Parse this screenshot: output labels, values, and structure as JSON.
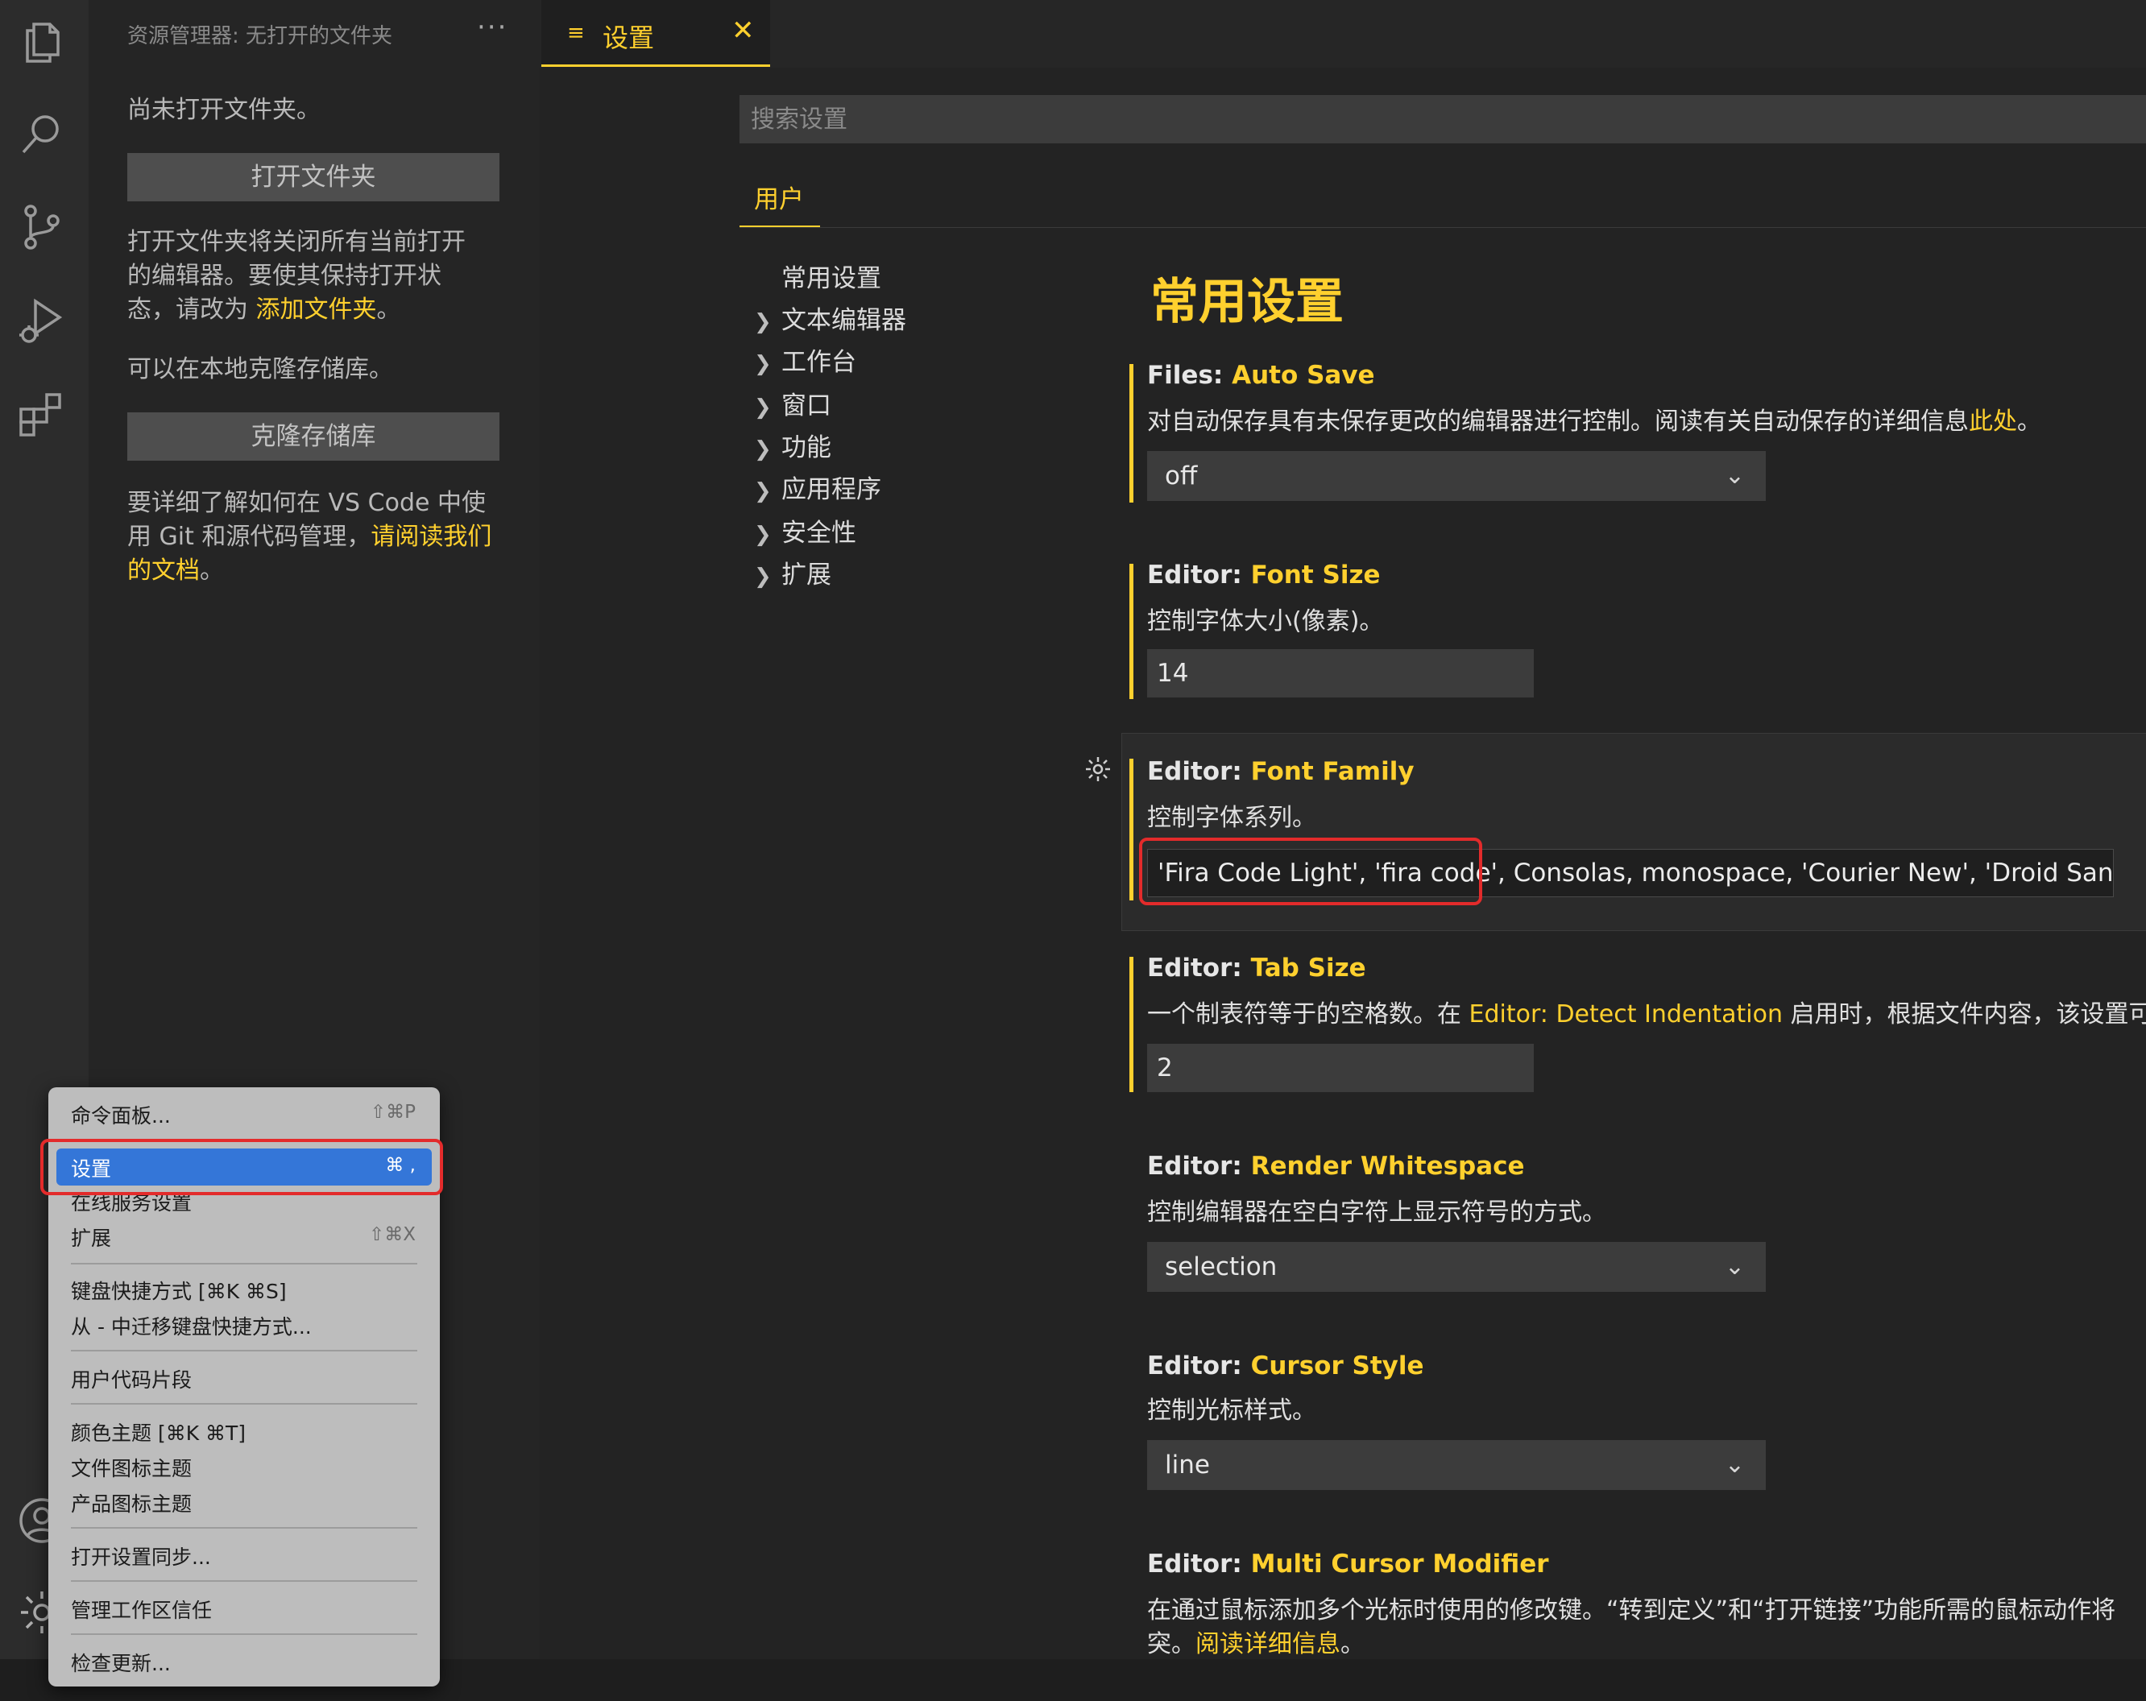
{
  "sidebar": {
    "title": "资源管理器: 无打开的文件夹",
    "more": "···",
    "no_folder": "尚未打开文件夹。",
    "open_folder_button": "打开文件夹",
    "open_folder_note_line1": "打开文件夹将关闭所有当前打开",
    "open_folder_note_line2": "的编辑器。要使其保持打开状",
    "open_folder_note_line3_prefix": "态，请改为 ",
    "open_folder_note_link": "添加文件夹",
    "open_folder_note_suffix": "。",
    "clone_note": "可以在本地克隆存储库。",
    "clone_button": "克隆存储库",
    "git_note_line1": "要详细了解如何在 VS Code 中使",
    "git_note_line2_prefix": "用 Git 和源代码管理，",
    "git_note_link_part1": "请阅读我们",
    "git_note_link_part2": "的文档",
    "git_note_suffix": "。"
  },
  "tab": {
    "icon": "≡",
    "label": "设置",
    "close": "✕"
  },
  "search": {
    "placeholder": "搜索设置"
  },
  "scope_tab": "用户",
  "toc": [
    {
      "label": "常用设置",
      "expandable": false
    },
    {
      "label": "文本编辑器",
      "expandable": true
    },
    {
      "label": "工作台",
      "expandable": true
    },
    {
      "label": "窗口",
      "expandable": true
    },
    {
      "label": "功能",
      "expandable": true
    },
    {
      "label": "应用程序",
      "expandable": true
    },
    {
      "label": "安全性",
      "expandable": true
    },
    {
      "label": "扩展",
      "expandable": true
    }
  ],
  "page_heading": "常用设置",
  "settings": {
    "auto_save": {
      "category": "Files: ",
      "key": "Auto Save",
      "desc_prefix": "对自动保存具有未保存更改的编辑器进行控制。阅读有关自动保存的详细信息",
      "desc_link": "此处",
      "desc_suffix": "。",
      "value": "off"
    },
    "font_size": {
      "category": "Editor: ",
      "key": "Font Size",
      "desc": "控制字体大小(像素)。",
      "value": "14"
    },
    "font_family": {
      "category": "Editor: ",
      "key": "Font Family",
      "desc": "控制字体系列。",
      "value": "'Fira Code Light', 'fira code', Consolas, monospace, 'Courier New', 'Droid Sans Fallb"
    },
    "tab_size": {
      "category": "Editor: ",
      "key": "Tab Size",
      "desc_prefix": "一个制表符等于的空格数。在 ",
      "desc_link": "Editor: Detect Indentation",
      "desc_suffix": " 启用时，根据文件内容，该设置可",
      "value": "2"
    },
    "render_whitespace": {
      "category": "Editor: ",
      "key": "Render Whitespace",
      "desc": "控制编辑器在空白字符上显示符号的方式。",
      "value": "selection"
    },
    "cursor_style": {
      "category": "Editor: ",
      "key": "Cursor Style",
      "desc": "控制光标样式。",
      "value": "line"
    },
    "multi_cursor": {
      "category": "Editor: ",
      "key": "Multi Cursor Modifier",
      "desc_line1": "在通过鼠标添加多个光标时使用的修改键。“转到定义”和“打开链接”功能所需的鼠标动作将",
      "desc_line2_prefix": "突。",
      "desc_link": "阅读详细信息",
      "desc_suffix": "。"
    }
  },
  "menu": {
    "items": [
      {
        "label": "命令面板...",
        "shortcut": "⇧⌘P"
      },
      {
        "label": "设置",
        "shortcut": "⌘ ,",
        "highlighted": true
      },
      {
        "label": "在线服务设置",
        "shortcut": ""
      },
      {
        "label": "扩展",
        "shortcut": "⇧⌘X"
      },
      {
        "label": "键盘快捷方式 [⌘K ⌘S]",
        "shortcut": ""
      },
      {
        "label": "从 - 中迁移键盘快捷方式...",
        "shortcut": ""
      },
      {
        "label": "用户代码片段",
        "shortcut": ""
      },
      {
        "label": "颜色主题 [⌘K ⌘T]",
        "shortcut": ""
      },
      {
        "label": "文件图标主题",
        "shortcut": ""
      },
      {
        "label": "产品图标主题",
        "shortcut": ""
      },
      {
        "label": "打开设置同步...",
        "shortcut": ""
      },
      {
        "label": "管理工作区信任",
        "shortcut": ""
      },
      {
        "label": "检查更新...",
        "shortcut": ""
      }
    ]
  },
  "colors": {
    "accent": "#ffd02e",
    "highlight": "#3476d8",
    "annotation": "#e32b2b"
  },
  "icons": [
    "files-icon",
    "search-icon",
    "source-control-icon",
    "run-debug-icon",
    "extensions-icon",
    "account-icon",
    "manage-gear-icon",
    "settings-gear-icon"
  ]
}
